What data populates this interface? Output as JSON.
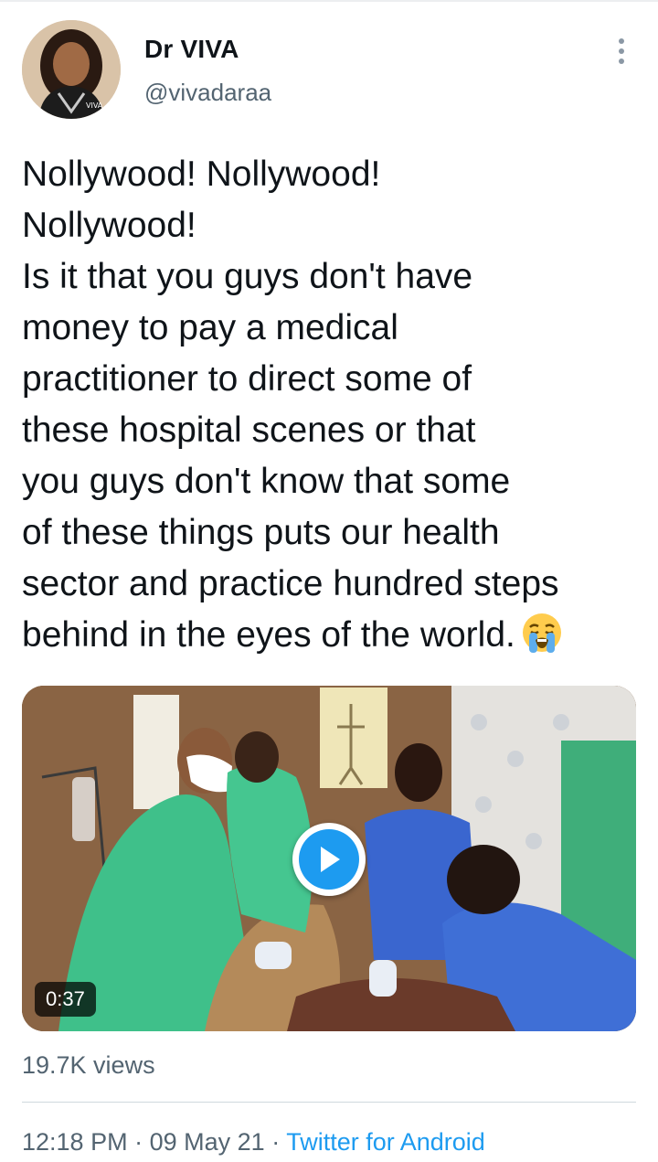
{
  "author": {
    "display_name": "Dr VIVA",
    "handle": "@vivadaraa",
    "avatar_icon": "profile-photo"
  },
  "tweet": {
    "text": "Nollywood! Nollywood!\nNollywood!\nIs it that you guys don't have\nmoney to pay a medical\npractitioner to direct some of\nthese hospital scenes or that\nyou guys don't know that some\nof these things puts our health\nsector and practice hundred steps\nbehind in the eyes of the world.",
    "emoji": "loudly-crying-face"
  },
  "media": {
    "type": "video",
    "duration": "0:37",
    "play_icon": "play-icon"
  },
  "stats": {
    "views": "19.7K views"
  },
  "meta": {
    "time": "12:18 PM",
    "separator": "·",
    "date": "09 May 21",
    "source": "Twitter for Android"
  },
  "colors": {
    "link": "#1d9bf0",
    "secondary_text": "#536471",
    "primary_text": "#0f1419"
  }
}
